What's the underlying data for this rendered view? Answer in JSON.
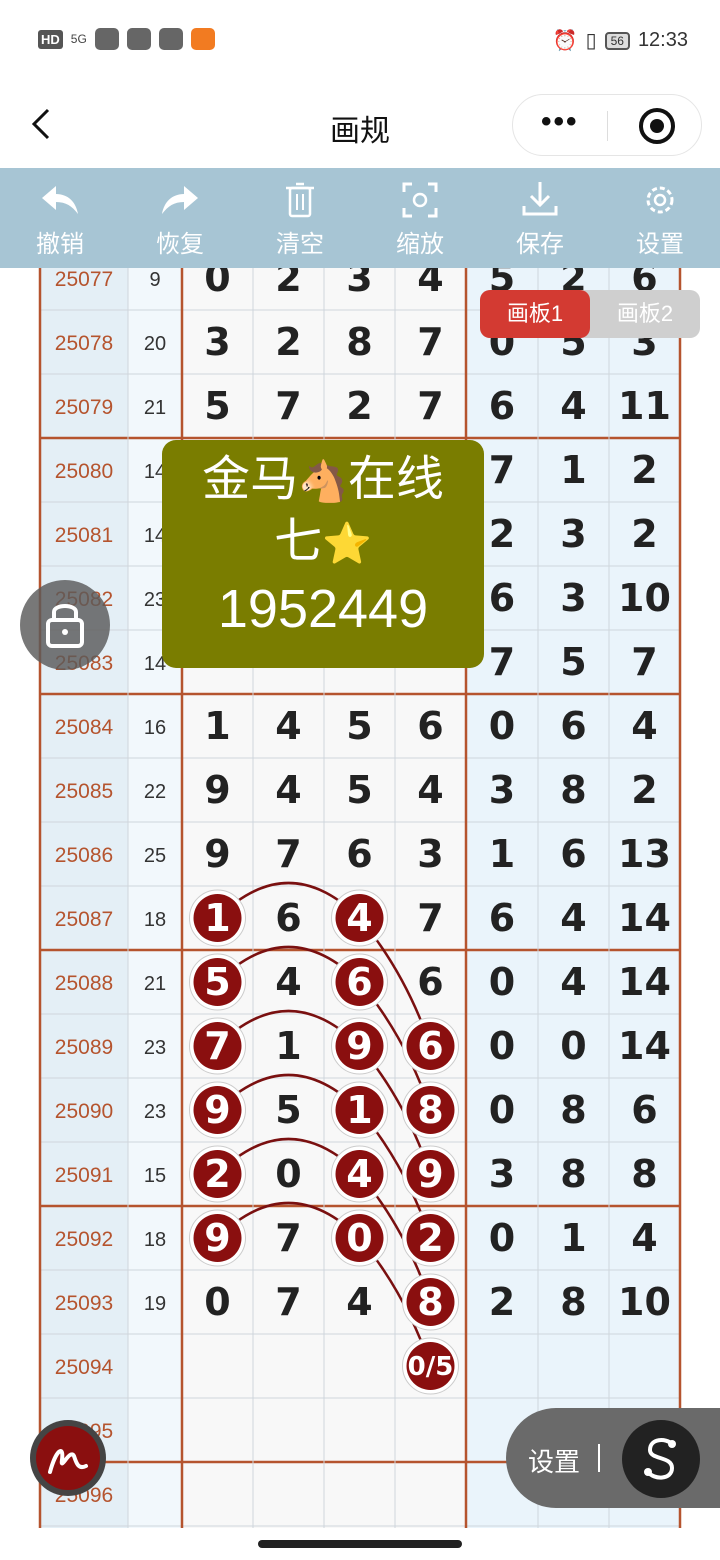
{
  "status": {
    "badge": "HD",
    "signal": "5G",
    "battery": "56",
    "time": "12:33"
  },
  "header": {
    "title": "画规",
    "more": "•••"
  },
  "toolbar": [
    {
      "label": "撤销",
      "icon": "undo-icon"
    },
    {
      "label": "恢复",
      "icon": "redo-icon"
    },
    {
      "label": "清空",
      "icon": "trash-icon"
    },
    {
      "label": "缩放",
      "icon": "zoom-icon"
    },
    {
      "label": "保存",
      "icon": "download-icon"
    },
    {
      "label": "设置",
      "icon": "gear-icon"
    }
  ],
  "tabs": [
    "画板1",
    "画板2"
  ],
  "promo": {
    "line1a": "金马",
    "line1b": "在线",
    "line2": "七",
    "line3": "1952449"
  },
  "float": {
    "settings": "设置"
  },
  "colors": {
    "toolbar_bg": "#a7c5d4",
    "grid_border": "#b5542e",
    "period_text": "#b5542e",
    "marker": "#8a0f0f",
    "tab_active": "#d33a32",
    "promo_bg": "#7a7d00"
  },
  "rows": [
    {
      "period": "25077",
      "sum": "9",
      "nums": [
        "0",
        "2",
        "3",
        "4",
        "5",
        "2",
        "6"
      ]
    },
    {
      "period": "25078",
      "sum": "20",
      "nums": [
        "3",
        "2",
        "8",
        "7",
        "0",
        "5",
        "3"
      ]
    },
    {
      "period": "25079",
      "sum": "21",
      "nums": [
        "5",
        "7",
        "2",
        "7",
        "6",
        "4",
        "11"
      ]
    },
    {
      "period": "25080",
      "sum": "14",
      "nums": [
        "",
        "",
        "",
        "",
        "7",
        "1",
        "2"
      ]
    },
    {
      "period": "25081",
      "sum": "14",
      "nums": [
        "",
        "",
        "",
        "",
        "2",
        "3",
        "2"
      ]
    },
    {
      "period": "25082",
      "sum": "23",
      "nums": [
        "",
        "",
        "",
        "",
        "6",
        "3",
        "10"
      ]
    },
    {
      "period": "25083",
      "sum": "14",
      "nums": [
        "",
        "",
        "",
        "",
        "7",
        "5",
        "7"
      ]
    },
    {
      "period": "25084",
      "sum": "16",
      "nums": [
        "1",
        "4",
        "5",
        "6",
        "0",
        "6",
        "4"
      ]
    },
    {
      "period": "25085",
      "sum": "22",
      "nums": [
        "9",
        "4",
        "5",
        "4",
        "3",
        "8",
        "2"
      ]
    },
    {
      "period": "25086",
      "sum": "25",
      "nums": [
        "9",
        "7",
        "6",
        "3",
        "1",
        "6",
        "13"
      ]
    },
    {
      "period": "25087",
      "sum": "18",
      "nums": [
        "1",
        "6",
        "4",
        "7",
        "6",
        "4",
        "14"
      ]
    },
    {
      "period": "25088",
      "sum": "21",
      "nums": [
        "5",
        "4",
        "6",
        "6",
        "0",
        "4",
        "14"
      ]
    },
    {
      "period": "25089",
      "sum": "23",
      "nums": [
        "7",
        "1",
        "9",
        "6",
        "0",
        "0",
        "14"
      ]
    },
    {
      "period": "25090",
      "sum": "23",
      "nums": [
        "9",
        "5",
        "1",
        "8",
        "0",
        "8",
        "6"
      ]
    },
    {
      "period": "25091",
      "sum": "15",
      "nums": [
        "2",
        "0",
        "4",
        "9",
        "3",
        "8",
        "8"
      ]
    },
    {
      "period": "25092",
      "sum": "18",
      "nums": [
        "9",
        "7",
        "0",
        "2",
        "0",
        "1",
        "4"
      ]
    },
    {
      "period": "25093",
      "sum": "19",
      "nums": [
        "0",
        "7",
        "4",
        "8",
        "2",
        "8",
        "10"
      ]
    },
    {
      "period": "25094",
      "sum": "",
      "nums": [
        "",
        "",
        "",
        "0/5",
        "",
        "",
        ""
      ]
    },
    {
      "period": "25095",
      "sum": "",
      "nums": [
        "",
        "",
        "",
        "",
        "",
        "",
        ""
      ]
    },
    {
      "period": "25096",
      "sum": "",
      "nums": [
        "",
        "",
        "",
        "",
        "",
        "",
        ""
      ]
    }
  ],
  "circled": [
    {
      "row": 10,
      "col": 0
    },
    {
      "row": 10,
      "col": 2
    },
    {
      "row": 11,
      "col": 0
    },
    {
      "row": 11,
      "col": 2
    },
    {
      "row": 12,
      "col": 0
    },
    {
      "row": 12,
      "col": 2
    },
    {
      "row": 12,
      "col": 3
    },
    {
      "row": 13,
      "col": 0
    },
    {
      "row": 13,
      "col": 2
    },
    {
      "row": 13,
      "col": 3
    },
    {
      "row": 14,
      "col": 0
    },
    {
      "row": 14,
      "col": 2
    },
    {
      "row": 14,
      "col": 3
    },
    {
      "row": 15,
      "col": 0
    },
    {
      "row": 15,
      "col": 2
    },
    {
      "row": 15,
      "col": 3
    },
    {
      "row": 16,
      "col": 3
    },
    {
      "row": 17,
      "col": 3
    }
  ]
}
